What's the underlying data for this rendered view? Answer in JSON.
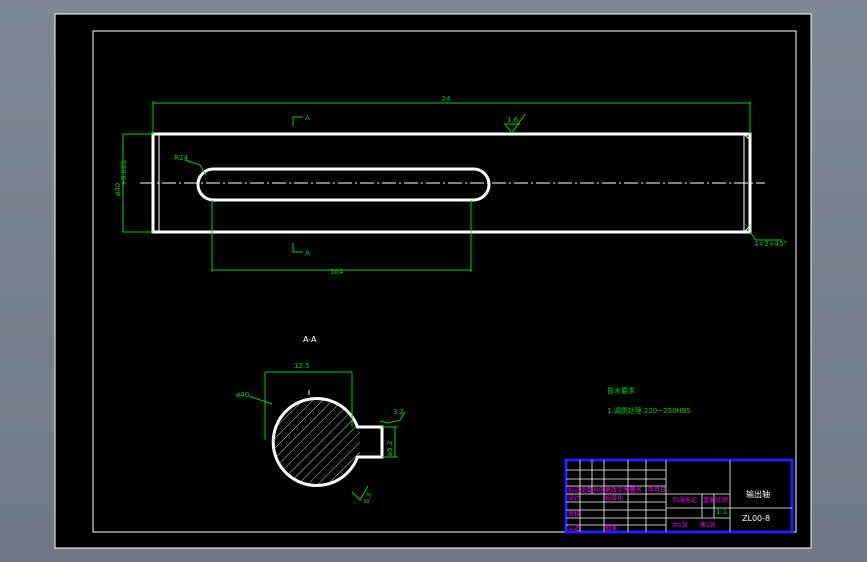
{
  "drawing": {
    "section_title": "A-A",
    "section_mark": "A",
    "dim_overall_length": "24",
    "dim_keyway_length": "104",
    "dim_diameter": "ø40",
    "dim_diameter_tol": "+0.025",
    "dim_keyway_radius": "R24",
    "dim_keyway_width": "12.5",
    "dim_keyway_depth": "ø5.2",
    "dim_chamfer": "1×2×45°",
    "roughness_top": "1.6",
    "roughness_key": "3.2",
    "roughness_bottom": "6.3",
    "dim_section_diameter": "ø40"
  },
  "notes": {
    "heading": "技术要求",
    "line1": "1.调质处理 220~250HBS"
  },
  "title_block": {
    "part_name": "输出轴",
    "drawing_no": "ZL00-8",
    "scale": "1:1",
    "sheet_total": "共1张",
    "sheet_no": "第1张",
    "label_mark": "标记",
    "label_qty": "处数",
    "label_zone": "分区",
    "label_change": "更改文件号",
    "label_sign": "签名",
    "label_date": "年月日",
    "label_design": "设计",
    "label_std": "标准化",
    "label_stage": "阶段标记",
    "label_weight": "重量",
    "label_ratio": "比例",
    "label_review": "审核",
    "label_craft": "工艺",
    "label_approve": "批准"
  }
}
